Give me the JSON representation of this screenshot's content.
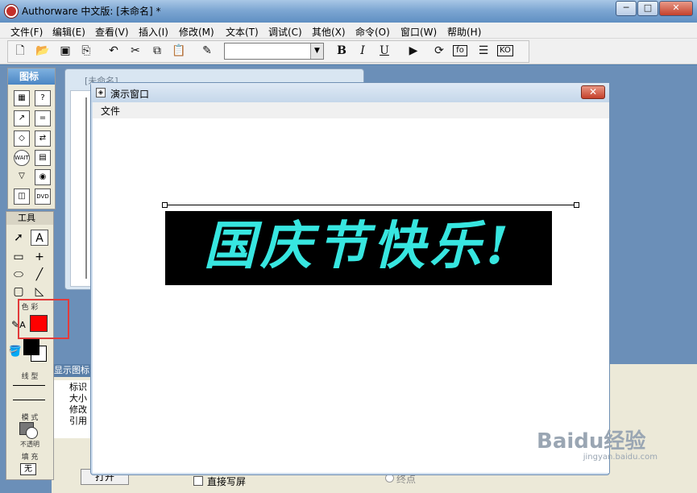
{
  "window": {
    "title": "Authorware 中文版: [未命名] *",
    "min_label": "─",
    "max_label": "□",
    "close_label": "✕"
  },
  "menu": {
    "items": [
      "文件(F)",
      "编辑(E)",
      "查看(V)",
      "插入(I)",
      "修改(M)",
      "文本(T)",
      "调试(C)",
      "其他(X)",
      "命令(O)",
      "窗口(W)",
      "帮助(H)"
    ]
  },
  "toolbar": {
    "icons": [
      "new-icon",
      "open-icon",
      "save-all-icon",
      "import-icon",
      "undo-icon",
      "cut-icon",
      "copy-icon",
      "paste-icon",
      "find-icon"
    ],
    "font_combo_value": "",
    "bold_label": "B",
    "italic_label": "I",
    "underline_label": "U",
    "extra_icons": [
      "run-icon",
      "restart-icon",
      "functions-icon",
      "variables-icon",
      "knowledge-objects-icon"
    ],
    "fo_label": "fo",
    "ko_label": "KO"
  },
  "icon_palette": {
    "title": "图标",
    "wait_label": "WAIT",
    "dvd_label": "DVD"
  },
  "back_window": {
    "title": "[未命名]"
  },
  "tools_panel": {
    "title": "工具",
    "color_label": "色 彩",
    "line_label": "线 型",
    "mode_label": "模 式",
    "mode_value": "不透明",
    "fill_label": "填 充",
    "fill_value": "无",
    "accent_red": "#ff0000"
  },
  "presentation_window": {
    "title": "演示窗口",
    "menu_file": "文件",
    "banner_text": "国庆节快乐!",
    "banner_color": "#37e6e0"
  },
  "properties_panel": {
    "title": "显示图标",
    "rows": [
      "标识",
      "大小",
      "修改",
      "引用"
    ],
    "open_button": "打开",
    "direct_write_label": "直接写屏",
    "endpoint_label": "终点"
  },
  "watermark": {
    "brand": "Baidu经验",
    "url": "jingyan.baidu.com"
  }
}
